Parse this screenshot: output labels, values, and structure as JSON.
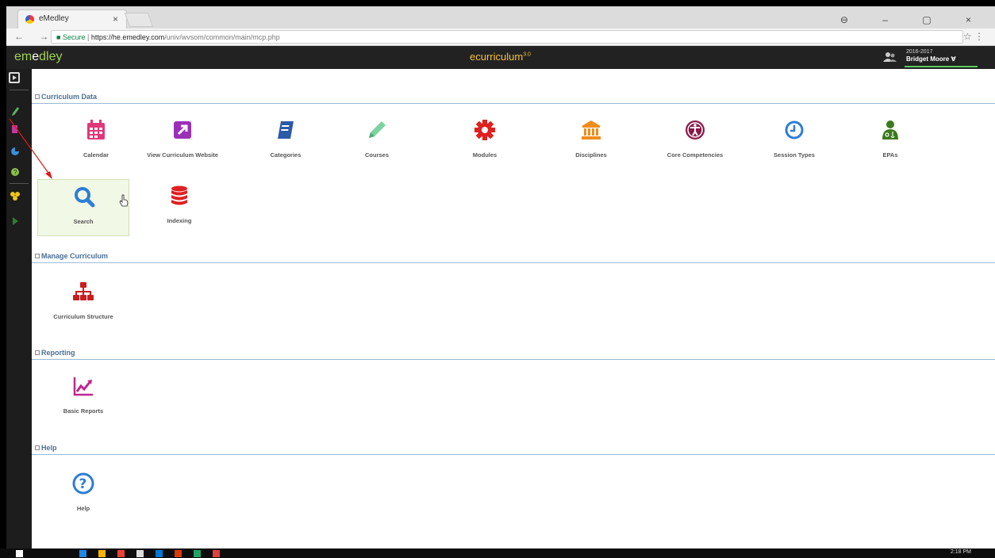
{
  "browser": {
    "tab_title": "eMedley",
    "tab_close": "×",
    "window_controls": "⊖ – ▢ ×",
    "nav_buttons": "← → C",
    "secure_label": "Secure",
    "url_host": "https://he.emedley.com",
    "url_path": "/univ/wvsom/common/main/mcp.php",
    "star": "☆ ⋮"
  },
  "header": {
    "logo_em": "em",
    "logo_dot": "e",
    "logo_dley": "dley",
    "app_title": "ecurriculum",
    "app_version": "3.0",
    "user_year": "2016-2017",
    "user_name": "Bridget Moore ∀"
  },
  "sections": [
    {
      "title": "Curriculum Data"
    },
    {
      "title": "Manage Curriculum"
    },
    {
      "title": "Reporting"
    },
    {
      "title": "Help"
    }
  ],
  "tiles": {
    "calendar": "Calendar",
    "view_website": "View Curriculum Website",
    "categories": "Categories",
    "courses": "Courses",
    "modules": "Modules",
    "disciplines": "Disciplines",
    "core_competencies": "Core Competencies",
    "session_types": "Session Types",
    "epas": "EPAs",
    "search": "Search",
    "indexing": "Indexing",
    "curriculum_structure": "Curriculum Structure",
    "basic_reports": "Basic Reports",
    "help": "Help"
  },
  "taskbar": {
    "time": "2:18 PM"
  },
  "colors": {
    "header_bg": "#222222",
    "accent_green": "#9fd154",
    "title_gold": "#f7c23a",
    "section_blue": "#4a6f96"
  }
}
